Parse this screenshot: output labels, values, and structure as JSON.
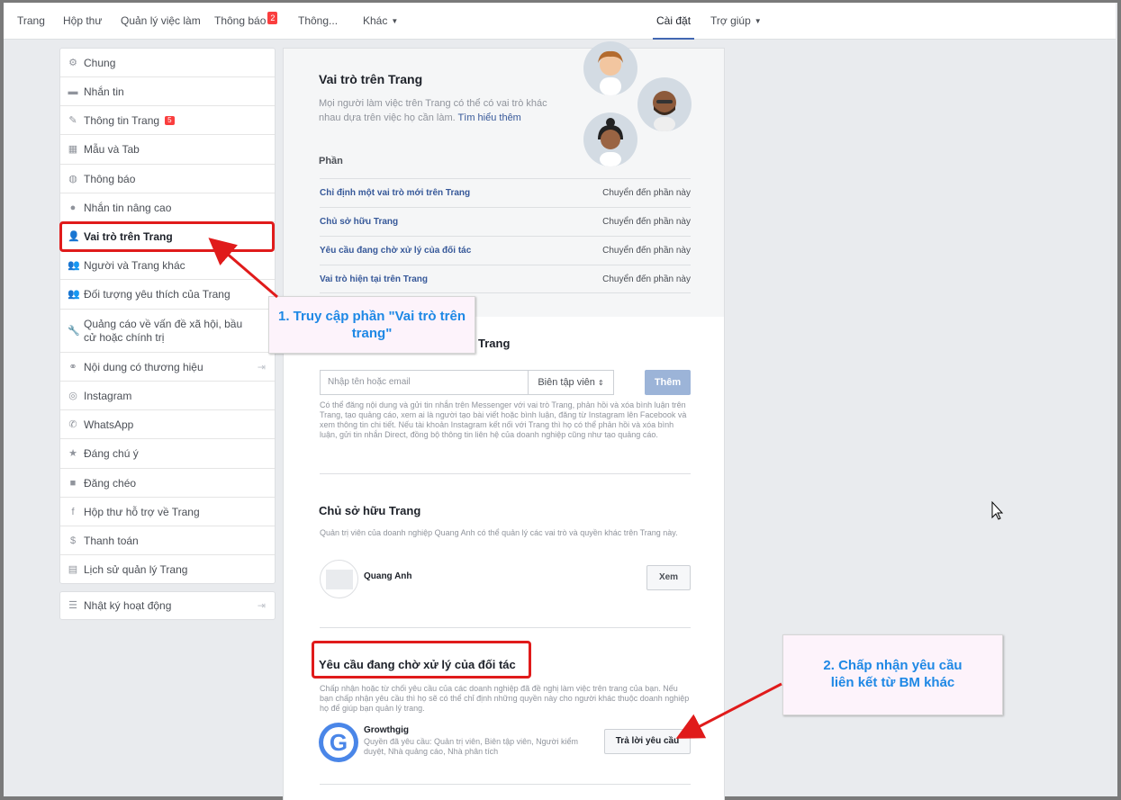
{
  "topnav": {
    "items": [
      {
        "label": "Trang"
      },
      {
        "label": "Hộp thư"
      },
      {
        "label": "Quản lý việc làm"
      },
      {
        "label": "Thông báo",
        "badge": "2"
      },
      {
        "label": "Thông..."
      },
      {
        "label": "Khác"
      }
    ],
    "settings": "Cài đặt",
    "help": "Trợ giúp"
  },
  "sidebar": {
    "items": [
      {
        "label": "Chung",
        "icon": "gear-icon"
      },
      {
        "label": "Nhắn tin",
        "icon": "message-icon"
      },
      {
        "label": "Thông tin Trang",
        "icon": "pencil-icon",
        "badge": "5"
      },
      {
        "label": "Mẫu và Tab",
        "icon": "grid-icon"
      },
      {
        "label": "Thông báo",
        "icon": "globe-icon"
      },
      {
        "label": "Nhắn tin nâng cao",
        "icon": "chat-bubble-icon"
      },
      {
        "label": "Vai trò trên Trang",
        "icon": "person-icon"
      },
      {
        "label": "Người và Trang khác",
        "icon": "people-icon"
      },
      {
        "label": "Đối tượng yêu thích của Trang",
        "icon": "people-icon"
      },
      {
        "label": "Quảng cáo về vấn đề xã hội, bầu cử hoặc chính trị",
        "icon": "wrench-icon"
      },
      {
        "label": "Nội dung có thương hiệu",
        "icon": "handshake-icon"
      },
      {
        "label": "Instagram",
        "icon": "instagram-icon"
      },
      {
        "label": "WhatsApp",
        "icon": "whatsapp-icon"
      },
      {
        "label": "Đáng chú ý",
        "icon": "star-icon"
      },
      {
        "label": "Đăng chéo",
        "icon": "video-icon"
      },
      {
        "label": "Hộp thư hỗ trợ về Trang",
        "icon": "facebook-icon"
      },
      {
        "label": "Thanh toán",
        "icon": "dollar-icon"
      },
      {
        "label": "Lịch sử quản lý Trang",
        "icon": "history-icon"
      }
    ],
    "activity_log": "Nhật ký hoạt động"
  },
  "main": {
    "title": "Vai trò trên Trang",
    "description": "Mọi người làm việc trên Trang có thể có vai trò khác nhau dựa trên việc họ cần làm.",
    "learn_more": "Tìm hiểu thêm",
    "sections_heading": "Phần",
    "sections": [
      {
        "label": "Chỉ định một vai trò mới trên Trang",
        "action": "Chuyển đến phần này"
      },
      {
        "label": "Chủ sở hữu Trang",
        "action": "Chuyển đến phần này"
      },
      {
        "label": "Yêu cầu đang chờ xử lý của đối tác",
        "action": "Chuyển đến phần này"
      },
      {
        "label": "Vai trò hiện tại trên Trang",
        "action": "Chuyển đến phần này"
      }
    ],
    "assign": {
      "heading_tail": "Trang",
      "input_placeholder": "Nhập tên hoặc email",
      "role_select": "Biên tập viên",
      "add_button": "Thêm",
      "help_text": "Có thể đăng nội dung và gửi tin nhắn trên Messenger với vai trò Trang, phản hồi và xóa bình luận trên Trang, tạo quảng cáo, xem ai là người tạo bài viết hoặc bình luận, đăng từ Instagram lên Facebook và xem thông tin chi tiết. Nếu tài khoản Instagram kết nối với Trang thì họ có thể phản hồi và xóa bình luận, gửi tin nhắn Direct, đồng bộ thông tin liên hệ của doanh nghiệp cũng như tạo quảng cáo."
    },
    "owner": {
      "heading": "Chủ sở hữu Trang",
      "description": "Quản trị viên của doanh nghiệp Quang Anh có thể quản lý các vai trò và quyền khác trên Trang này.",
      "name": "Quang Anh",
      "view_button": "Xem"
    },
    "pending": {
      "heading": "Yêu cầu đang chờ xử lý của đối tác",
      "description": "Chấp nhận hoặc từ chối yêu cầu của các doanh nghiệp đã đề nghị làm việc trên trang của bạn. Nếu bạn chấp nhận yêu cầu thì họ sẽ có thể chỉ định những quyền này cho người khác thuộc doanh nghiệp họ để giúp bạn quản lý trang.",
      "partner_name": "Growthgig",
      "partner_logo": "G",
      "permissions": "Quyền đã yêu cầu: Quản trị viên, Biên tập viên, Người kiểm duyệt, Nhà quảng cáo, Nhà phân tích",
      "reply_button": "Trả lời yêu cầu"
    }
  },
  "annotations": {
    "callout1": "1. Truy cập phần \"Vai trò trên trang\"",
    "callout2": "2. Chấp nhận yêu cầu liên kết từ BM khác"
  },
  "colors": {
    "accent": "#4267b2",
    "link": "#365899",
    "annotation_red": "#e01b1b",
    "annotation_text": "#1e88e5"
  }
}
